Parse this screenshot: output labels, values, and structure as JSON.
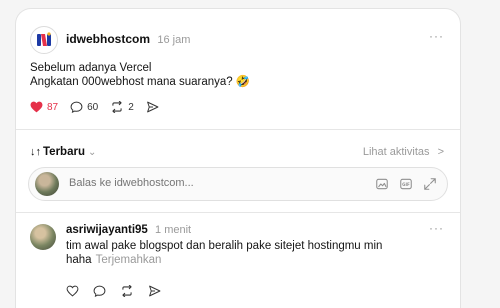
{
  "post": {
    "username": "idwebhostcom",
    "time": "16 jam",
    "more_label": "···",
    "lines": [
      "Sebelum adanya Vercel",
      "Angkatan 000webhost mana suaranya? 🤣"
    ],
    "likes": "87",
    "comments": "60",
    "reposts": "2",
    "liked": true,
    "accent_color": "#e5314a",
    "avatar_icon": "idwebhost-logo-icon"
  },
  "sortbar": {
    "arrows": "↓↑",
    "label": "Terbaru",
    "chevron": "⌄",
    "activity_label": "Lihat aktivitas",
    "activity_chevron": ">"
  },
  "reply": {
    "placeholder": "Balas ke idwebhostcom...",
    "icons": [
      "image-icon",
      "gif-icon",
      "expand-icon"
    ]
  },
  "comment": {
    "username": "asriwijayanti95",
    "time": "1 menit",
    "more_label": "···",
    "text_line1": "tim awal pake blogspot dan beralih pake sitejet hostingmu min",
    "text_line2": "haha",
    "translate_label": "Terjemahkan"
  }
}
